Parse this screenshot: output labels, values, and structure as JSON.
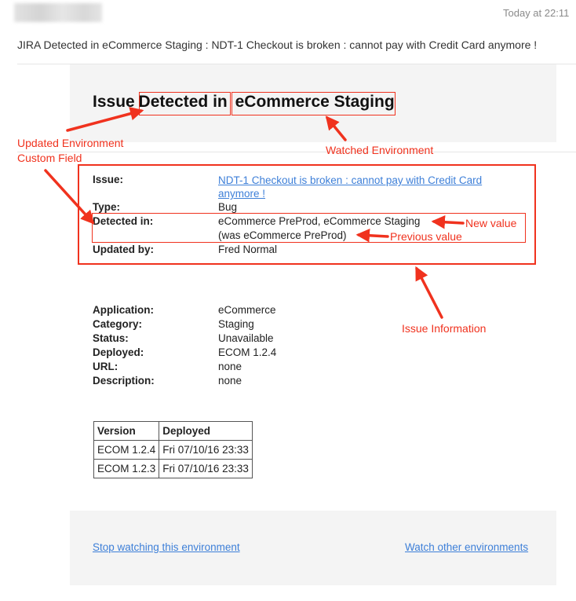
{
  "email": {
    "timestamp": "Today at 22:11",
    "subject": "JIRA Detected in eCommerce Staging : NDT-1 Checkout is broken : cannot pay with Credit Card anymore !"
  },
  "heading": {
    "prefix": "Issue ",
    "detected": "Detected in",
    "environment": "eCommerce Staging"
  },
  "issue": {
    "issue_label": "Issue:",
    "issue_link_line1": "NDT-1 Checkout is broken : cannot pay with Credit Card",
    "issue_link_line2": "anymore !",
    "type_label": "Type:",
    "type_value": "Bug",
    "detected_label": "Detected in:",
    "detected_value": "eCommerce PreProd, eCommerce Staging",
    "detected_previous": "(was eCommerce PreProd)",
    "updated_label": "Updated by:",
    "updated_value": "Fred Normal"
  },
  "environment": {
    "rows": [
      {
        "label": "Application:",
        "value": "eCommerce"
      },
      {
        "label": "Category:",
        "value": "Staging"
      },
      {
        "label": "Status:",
        "value": "Unavailable"
      },
      {
        "label": "Deployed:",
        "value": "ECOM 1.2.4"
      },
      {
        "label": "URL:",
        "value": "none"
      },
      {
        "label": "Description:",
        "value": "none"
      }
    ]
  },
  "versions_table": {
    "headers": [
      "Version",
      "Deployed"
    ],
    "rows": [
      [
        "ECOM 1.2.4",
        "Fri 07/10/16 23:33"
      ],
      [
        "ECOM 1.2.3",
        "Fri 07/10/16 23:33"
      ]
    ]
  },
  "footer": {
    "stop_watching": "Stop watching this environment",
    "watch_other": "Watch other environments"
  },
  "annotations": {
    "updated_env_line1": "Updated Environment",
    "updated_env_line2": "Custom Field",
    "watched_env": "Watched Environment",
    "new_value": "New value",
    "previous_value": "Previous value",
    "issue_information": "Issue Information"
  },
  "colors": {
    "annotation": "#f0321e",
    "link": "#3d7fd8",
    "panel": "#f4f4f4"
  }
}
